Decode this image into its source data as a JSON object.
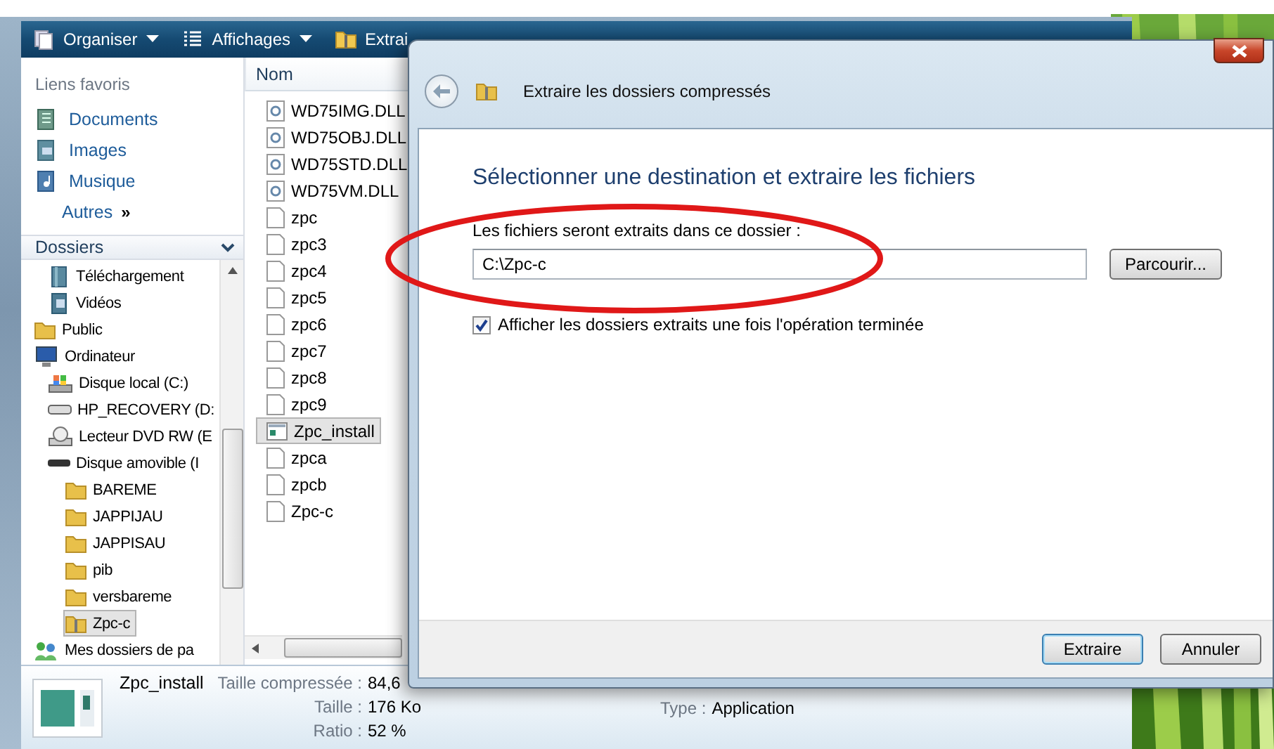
{
  "explorer": {
    "toolbar": [
      {
        "kind": "organize",
        "label": "Organiser",
        "dropdown": true
      },
      {
        "kind": "views",
        "label": "Affichages",
        "dropdown": true
      },
      {
        "kind": "extract",
        "label": "Extrai",
        "dropdown": false
      }
    ],
    "favorites": {
      "title": "Liens favoris",
      "items": [
        {
          "kind": "documents",
          "label": "Documents"
        },
        {
          "kind": "pictures",
          "label": "Images"
        },
        {
          "kind": "music",
          "label": "Musique"
        }
      ],
      "more": {
        "label": "Autres",
        "glyph": "»"
      }
    },
    "folders": {
      "title": "Dossiers",
      "tree": [
        {
          "children": [
            {
              "label": "Téléchargement",
              "kind": "library",
              "selected": false
            },
            {
              "label": "Vidéos",
              "kind": "video",
              "selected": false
            }
          ]
        },
        {
          "label": "Public",
          "kind": "folder",
          "selected": false
        },
        {
          "label": "Ordinateur",
          "kind": "computer",
          "selected": false,
          "children": [
            {
              "label": "Disque local (C:)",
              "kind": "system-drive",
              "selected": false
            },
            {
              "label": "HP_RECOVERY (D:",
              "kind": "drive",
              "selected": false
            },
            {
              "label": "Lecteur DVD RW (E",
              "kind": "dvd",
              "selected": false
            },
            {
              "label": "Disque amovible (I",
              "kind": "usb",
              "selected": false,
              "children": [
                {
                  "label": "BAREME",
                  "kind": "folder",
                  "selected": false
                },
                {
                  "label": "JAPPIJAU",
                  "kind": "folder",
                  "selected": false
                },
                {
                  "label": "JAPPISAU",
                  "kind": "folder",
                  "selected": false
                },
                {
                  "label": "pib",
                  "kind": "folder",
                  "selected": false
                },
                {
                  "label": "versbareme",
                  "kind": "folder",
                  "selected": false
                },
                {
                  "label": "Zpc-c",
                  "kind": "zip",
                  "selected": true
                }
              ]
            }
          ]
        },
        {
          "label": "Mes dossiers de pa",
          "kind": "network",
          "selected": false
        }
      ]
    },
    "files": {
      "column": "Nom",
      "items": [
        {
          "name": "WD75IMG.DLL",
          "kind": "dll",
          "selected": false
        },
        {
          "name": "WD75OBJ.DLL",
          "kind": "dll",
          "selected": false
        },
        {
          "name": "WD75STD.DLL",
          "kind": "dll",
          "selected": false
        },
        {
          "name": "WD75VM.DLL",
          "kind": "dll",
          "selected": false
        },
        {
          "name": "zpc",
          "kind": "file",
          "selected": false
        },
        {
          "name": "zpc3",
          "kind": "file",
          "selected": false
        },
        {
          "name": "zpc4",
          "kind": "file",
          "selected": false
        },
        {
          "name": "zpc5",
          "kind": "file",
          "selected": false
        },
        {
          "name": "zpc6",
          "kind": "file",
          "selected": false
        },
        {
          "name": "zpc7",
          "kind": "file",
          "selected": false
        },
        {
          "name": "zpc8",
          "kind": "file",
          "selected": false
        },
        {
          "name": "zpc9",
          "kind": "file",
          "selected": false
        },
        {
          "name": "Zpc_install",
          "kind": "app",
          "selected": true
        },
        {
          "name": "zpca",
          "kind": "file",
          "selected": false
        },
        {
          "name": "zpcb",
          "kind": "file",
          "selected": false
        },
        {
          "name": "Zpc-c",
          "kind": "file",
          "selected": false
        }
      ]
    },
    "details": {
      "name": "Zpc_install",
      "fields": [
        {
          "label": "Taille compressée :",
          "value": "84,6"
        },
        {
          "label": "Taille :",
          "value": "176 Ko"
        },
        {
          "label": "Ratio :",
          "value": "52 %"
        }
      ],
      "type": {
        "label": "Type :",
        "value": "Application"
      }
    }
  },
  "dialog": {
    "title": "Extraire les dossiers compressés",
    "heading": "Sélectionner une destination et extraire les fichiers",
    "destination": {
      "label": "Les fichiers seront extraits dans ce dossier :",
      "value": "C:\\Zpc-c",
      "browse": "Parcourir..."
    },
    "show_when_done": {
      "label": "Afficher les dossiers extraits une fois l'opération terminée",
      "checked": true
    },
    "buttons": [
      {
        "label": "Extraire",
        "default": true
      },
      {
        "label": "Annuler",
        "default": false
      }
    ]
  }
}
